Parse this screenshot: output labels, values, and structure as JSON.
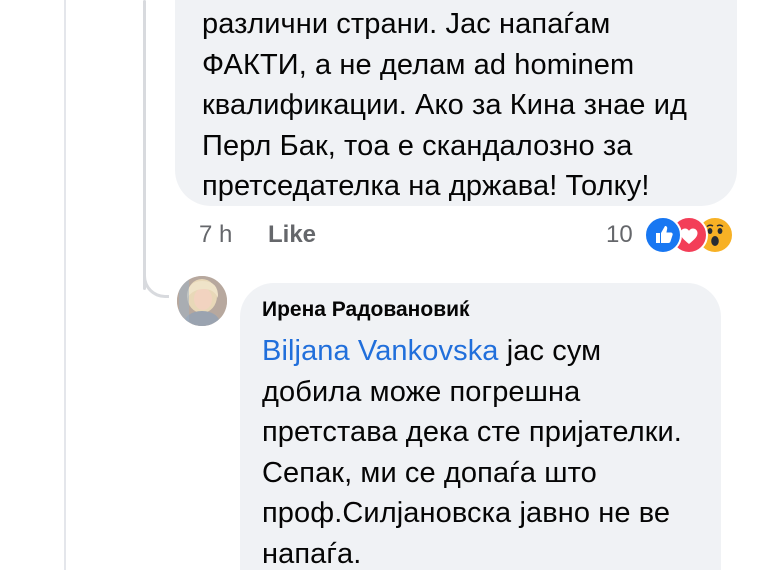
{
  "comment_1": {
    "text": "различни страни. Јас напаѓам\nФАКТИ, а не делам ad hominem\nквалификации. Ако за Кина знае ид\nПерл Бак, тоа е скандалозно за\nпретседателка на држава! Толку!",
    "time": "7 h",
    "like_label": "Like",
    "reaction_count": "10",
    "reactions": [
      "like-icon",
      "love-icon",
      "wow-icon"
    ]
  },
  "reply": {
    "author": "Ирена Радовановиќ",
    "mention": "Biljana Vankovska",
    "text": " јас сум\nдобила може погрешна\nпретстава дека сте пријателки.\nСепак, ми се допаѓа што\nпроф.Силјановска јавно не ве\nнапаѓа."
  },
  "colors": {
    "bubble": "#f0f2f5",
    "mention": "#216fdb",
    "meta": "#65676b",
    "like": "#1877f2",
    "love": "#f33e58",
    "wow": "#f7b125"
  }
}
